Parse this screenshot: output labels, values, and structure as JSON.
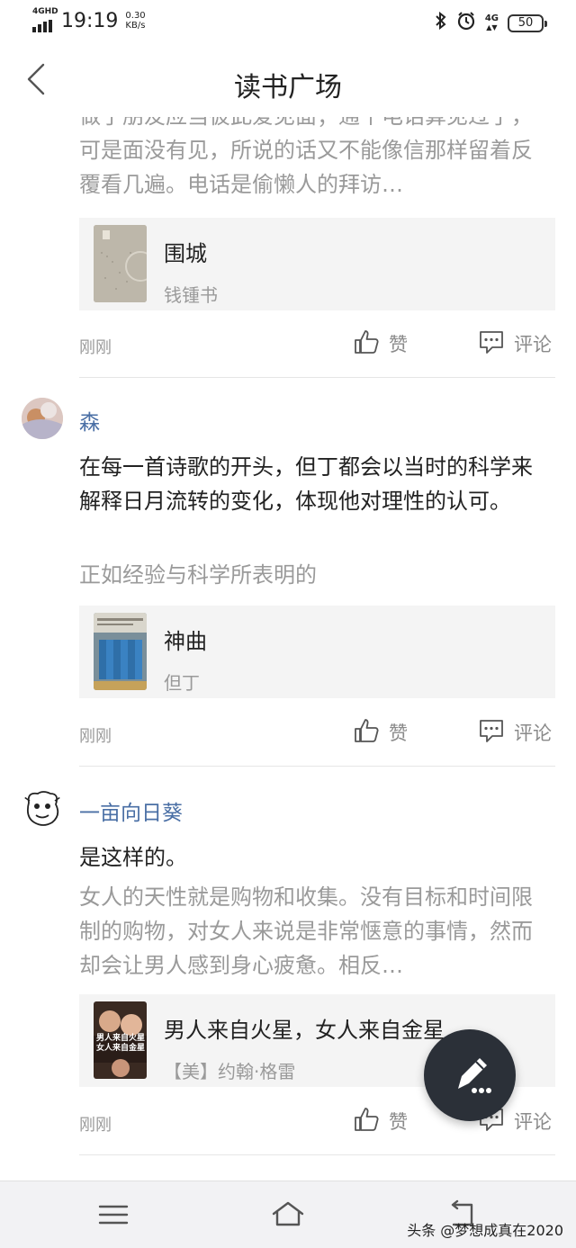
{
  "status_bar": {
    "network": "4GHD",
    "time": "19:19",
    "speed_value": "0.30",
    "speed_unit": "KB/s",
    "mobile_data": "4G",
    "battery": "50"
  },
  "header": {
    "title": "读书广场"
  },
  "posts": [
    {
      "quote": "做了朋友应当彼此爱见面；通个电话算见过了，可是面没有见，所说的话又不能像信那样留着反覆看几遍。电话是偷懒人的拜访…",
      "book": {
        "title": "围城",
        "author": "钱锺书"
      },
      "time": "刚刚",
      "like_label": "赞",
      "comment_label": "评论"
    },
    {
      "user": "森",
      "text": "在每一首诗歌的开头，但丁都会以当时的科学来解释日月流转的变化，体现他对理性的认可。",
      "quote": "正如经验与科学所表明的",
      "book": {
        "title": "神曲",
        "author": "但丁"
      },
      "time": "刚刚",
      "like_label": "赞",
      "comment_label": "评论"
    },
    {
      "user": "一亩向日葵",
      "text": "是这样的。",
      "quote": "女人的天性就是购物和收集。没有目标和时间限制的购物，对女人来说是非常惬意的事情，然而却会让男人感到身心疲惫。相反…",
      "book": {
        "title": "男人来自火星，女人来自金星",
        "author": "【美】约翰·格雷",
        "cover_text": "男人来自火星女人来自金星"
      },
      "time": "刚刚",
      "like_label": "赞",
      "comment_label": "评论"
    }
  ],
  "watermark": "头条 @梦想成真在2020",
  "icons": {
    "back": "chevron-left-icon",
    "like": "thumbs-up-icon",
    "comment": "comment-bubble-icon",
    "fab": "pen-icon",
    "nav": [
      "menu-icon",
      "home-icon",
      "return-icon"
    ]
  },
  "colors": {
    "username": "#4a6fa5",
    "muted": "#9a9a9a",
    "card_bg": "#f4f4f4",
    "fab_bg": "#2b3038"
  }
}
